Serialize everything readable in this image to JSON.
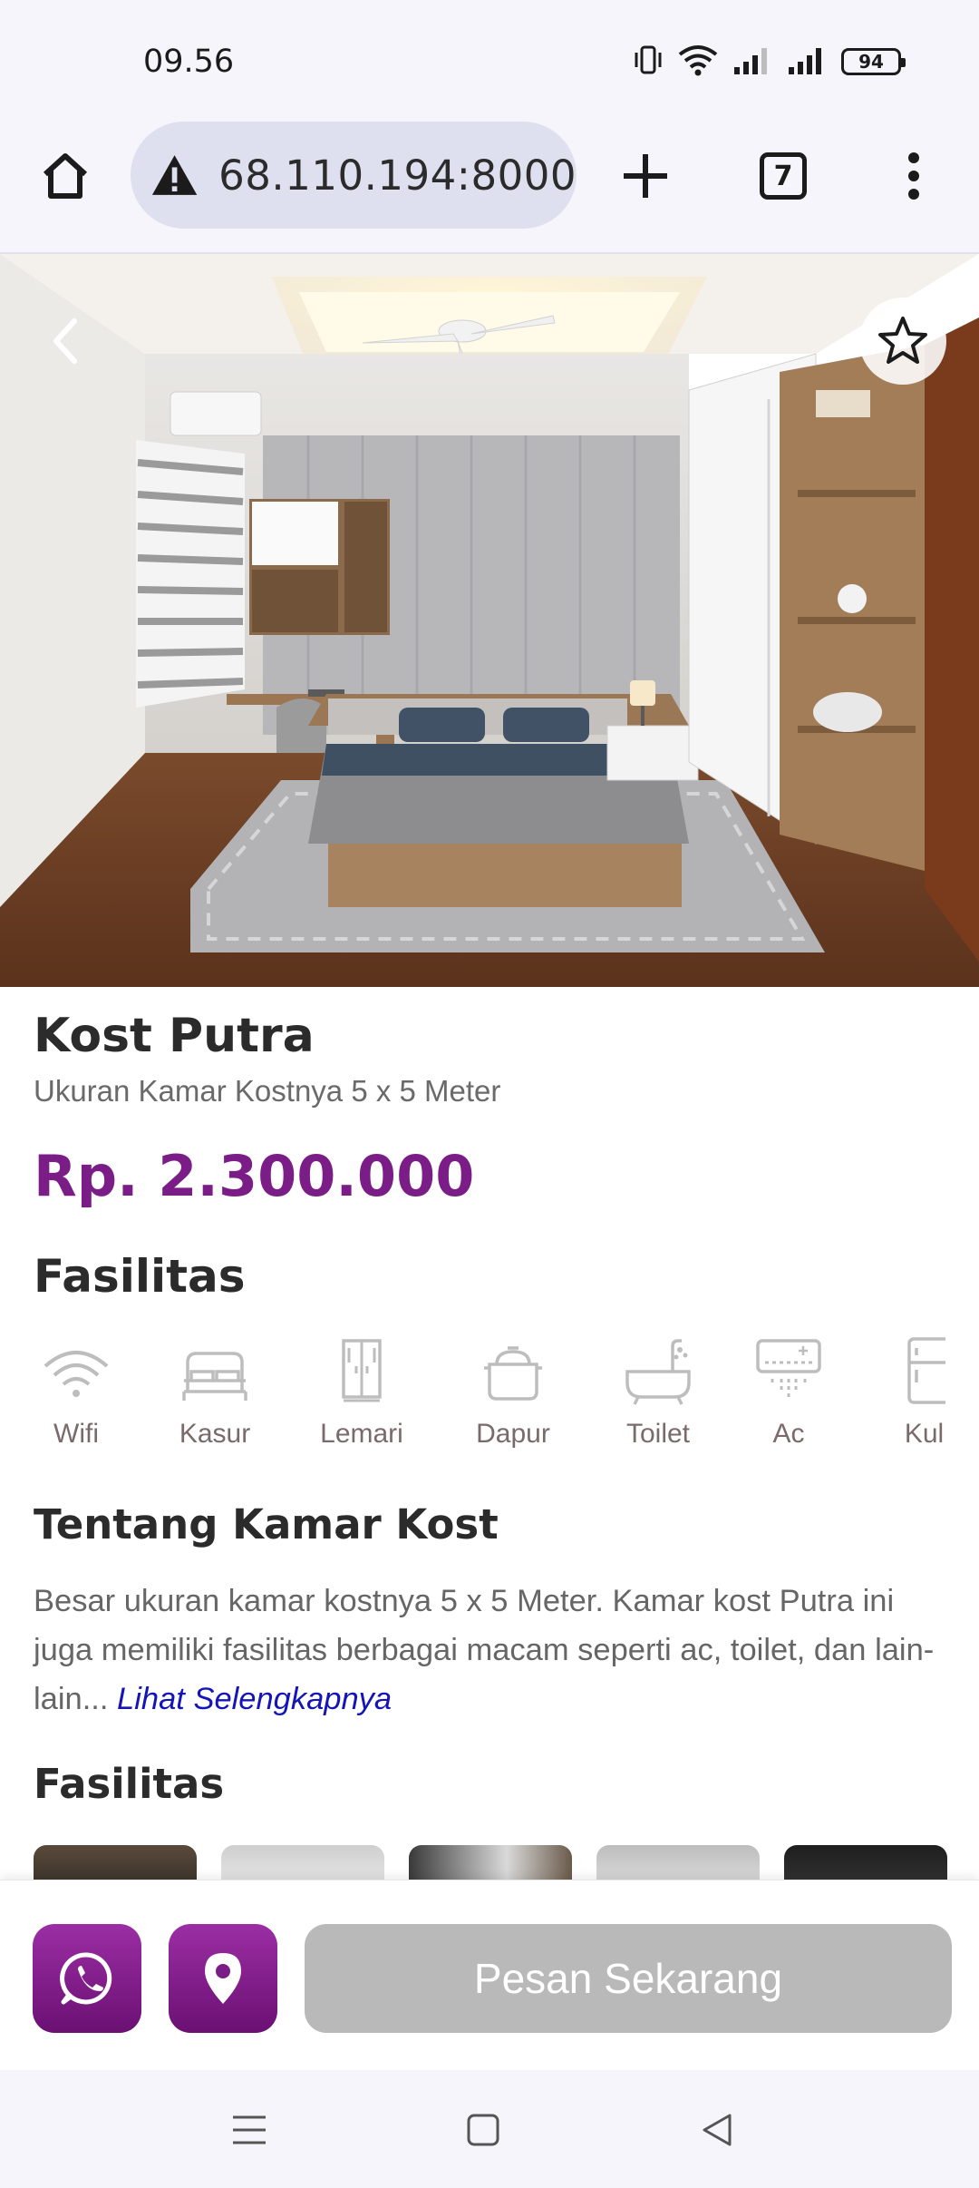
{
  "status_bar": {
    "time": "09.56",
    "battery": "94"
  },
  "browser": {
    "url": "68.110.194:8000",
    "tab_count": "7"
  },
  "room": {
    "title": "Kost Putra",
    "size": "Ukuran Kamar Kostnya 5 x 5 Meter",
    "price": "Rp. 2.300.000"
  },
  "facilities_heading": "Fasilitas",
  "facilities": [
    {
      "label": "Wifi",
      "icon": "wifi-icon"
    },
    {
      "label": "Kasur",
      "icon": "bed-icon"
    },
    {
      "label": "Lemari",
      "icon": "wardrobe-icon"
    },
    {
      "label": "Dapur",
      "icon": "pot-icon"
    },
    {
      "label": "Toilet",
      "icon": "bathtub-icon"
    },
    {
      "label": "Ac",
      "icon": "air-conditioner-icon"
    },
    {
      "label": "Kulk",
      "icon": "fridge-icon"
    }
  ],
  "about": {
    "heading": "Tentang Kamar Kost",
    "text": "Besar ukuran kamar kostnya 5 x 5 Meter. Kamar kost Putra ini juga memiliki fasilitas berbagai macam seperti ac, toilet, dan lain-lain... ",
    "see_more": "Lihat Selengkapnya"
  },
  "gallery_heading": "Fasilitas",
  "actions": {
    "order_label": "Pesan Sekarang"
  },
  "colors": {
    "accent": "#7b1d86",
    "link": "#1414b8",
    "disabled_button": "#b9b9b9"
  }
}
